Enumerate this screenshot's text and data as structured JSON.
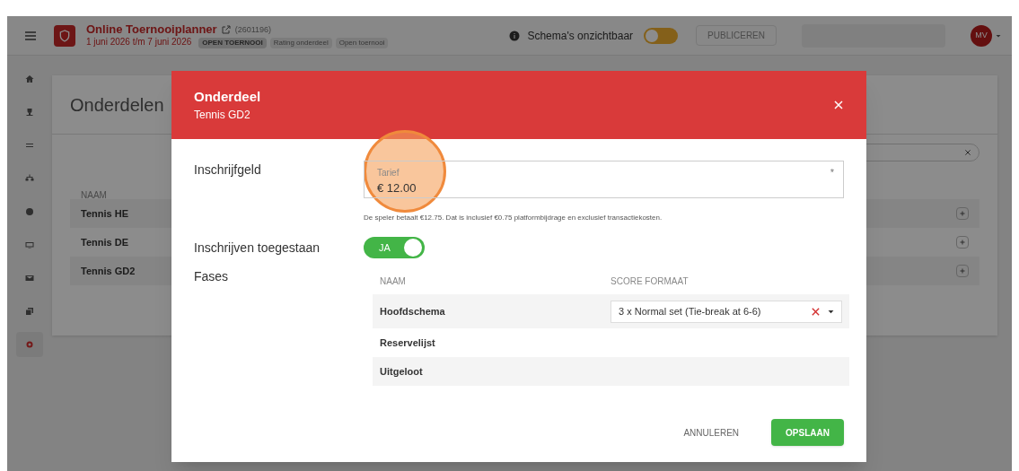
{
  "topbar": {
    "title": "Online Toernooiplanner",
    "tournament_id": "(2601196)",
    "dates": "1 juni 2026 t/m 7 juni 2026",
    "badges": [
      {
        "label": "OPEN TOERNOOI",
        "kind": "strong"
      },
      {
        "label": "Rating onderdeel",
        "kind": "light"
      },
      {
        "label": "Open toernooi",
        "kind": "light"
      }
    ],
    "visibility": {
      "label": "Schema's onzichtbaar",
      "on": false
    },
    "publish": {
      "label": "PUBLICEREN",
      "disabled": true
    },
    "avatar": "MV"
  },
  "sidebar": {
    "items": [
      {
        "selected": false
      },
      {
        "selected": false
      },
      {
        "selected": false
      },
      {
        "selected": false
      },
      {
        "selected": false
      },
      {
        "selected": false
      },
      {
        "selected": false
      },
      {
        "selected": false
      },
      {
        "selected": true
      }
    ]
  },
  "page": {
    "title": "Onderdelen",
    "column": "NAAM",
    "rows": [
      "Tennis HE",
      "Tennis DE",
      "Tennis GD2"
    ]
  },
  "modal": {
    "title": "Onderdeel",
    "subtitle": "Tennis GD2",
    "fee": {
      "label": "Inschrijfgeld",
      "field_label": "Tarief",
      "value": "€ 12.00",
      "required_mark": "*",
      "help": "De speler betaalt €12.75. Dat is inclusief €0.75 platformbijdrage en exclusief transactiekosten.",
      "highlighted": true
    },
    "allow": {
      "label": "Inschrijven toegestaan",
      "on": true,
      "on_text": "JA"
    },
    "phases": {
      "label": "Fases",
      "columns": [
        "NAAM",
        "SCORE FORMAAT"
      ],
      "rows": [
        {
          "name": "Hoofdschema",
          "score_format": "3 x Normal set (Tie-break at 6-6)"
        },
        {
          "name": "Reservelijst"
        },
        {
          "name": "Uitgeloot"
        }
      ]
    },
    "buttons": [
      {
        "label": "ANNULEREN",
        "kind": "text"
      },
      {
        "label": "OPSLAAN",
        "kind": "primary"
      }
    ]
  }
}
